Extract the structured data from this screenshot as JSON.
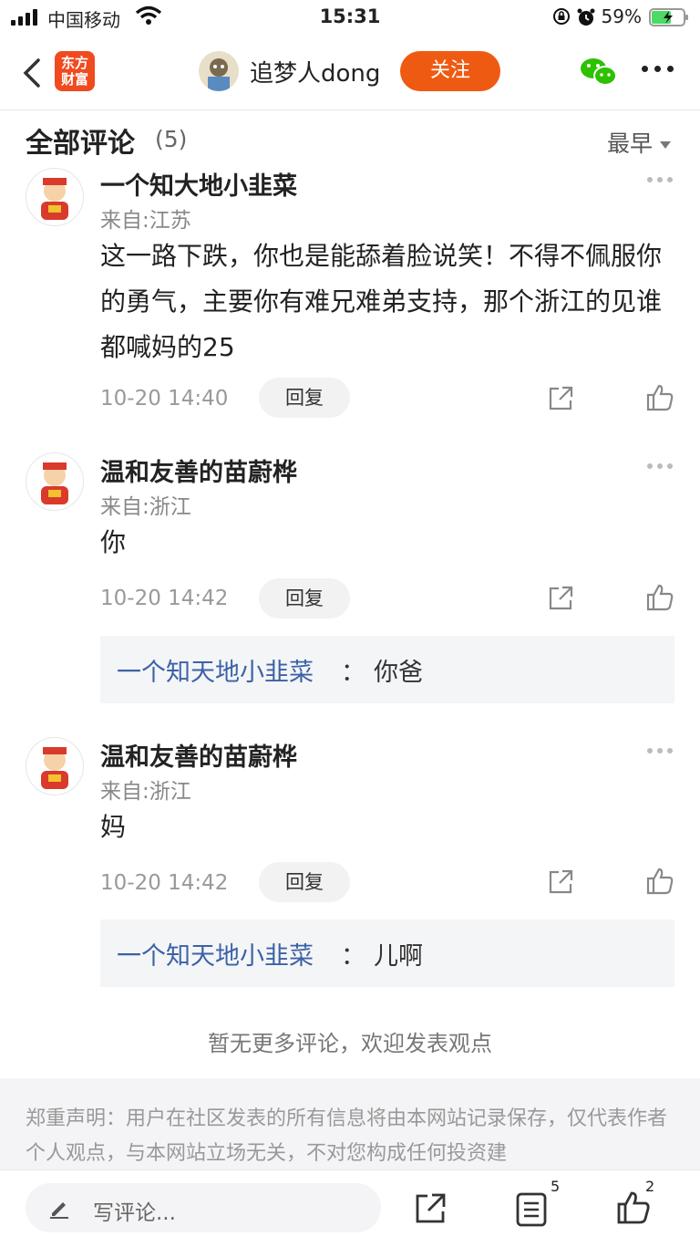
{
  "status_bar": {
    "carrier": "中国移动",
    "time": "15:31",
    "battery": "59%"
  },
  "header": {
    "logo_text": "东方财富",
    "author": "追梦人dong",
    "follow_label": "关注"
  },
  "comments_header": {
    "title": "全部评论",
    "count": "(5)",
    "sort": "最早"
  },
  "comments": [
    {
      "name": "一个知大地小韭菜",
      "location": "来自:江苏",
      "text": "这一路下跌，你也是能舔着脸说笑！不得不佩服你的勇气，主要你有难兄难弟支持，那个浙江的见谁都喊妈的25",
      "time": "10-20 14:40",
      "reply_label": "回复"
    },
    {
      "name": "温和友善的苗蔚桦",
      "location": "来自:浙江",
      "text": "你",
      "time": "10-20 14:42",
      "reply_label": "回复",
      "sub_reply": {
        "author": "一个知天地小韭菜",
        "sep": "：",
        "text": "你爸"
      }
    },
    {
      "name": "温和友善的苗蔚桦",
      "location": "来自:浙江",
      "text": "妈",
      "time": "10-20 14:42",
      "reply_label": "回复",
      "sub_reply": {
        "author": "一个知天地小韭菜",
        "sep": "：",
        "text": "儿啊"
      }
    }
  ],
  "no_more": "暂无更多评论，欢迎发表观点",
  "disclaimer": "郑重声明：用户在社区发表的所有信息将由本网站记录保存，仅代表作者个人观点，与本网站立场无关，不对您构成任何投资建",
  "bottom_bar": {
    "placeholder": "写评论...",
    "list_badge": "5",
    "like_badge": "2"
  },
  "colors": {
    "accent": "#ef5a12",
    "link": "#3c62a6",
    "wechat": "#2dc100"
  }
}
